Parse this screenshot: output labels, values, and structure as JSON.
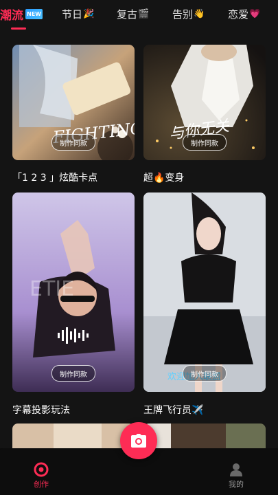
{
  "tabs": [
    {
      "label": "潮流",
      "badge": "NEW",
      "active": true
    },
    {
      "label": "节日",
      "emoji": "🎉"
    },
    {
      "label": "复古",
      "emoji": "🎬"
    },
    {
      "label": "告别",
      "emoji": "👋"
    },
    {
      "label": "恋爱",
      "emoji": "💗"
    }
  ],
  "cards": [
    {
      "title": "「1 2 3 」炫酷卡点",
      "button": "制作同款",
      "overlay_text": "FIGHTING!"
    },
    {
      "title": "超🔥变身",
      "button": "制作同款",
      "overlay_text": "与你无关"
    },
    {
      "title": "字幕投影玩法",
      "button": "制作同款",
      "overlay_text": "ETIE"
    },
    {
      "title": "王牌飞行员✈️",
      "button": "制作同款",
      "overlay_text": "欢迎加入联盟"
    }
  ],
  "bottom_nav": {
    "create": {
      "label": "创作",
      "icon": "create-icon",
      "active": true
    },
    "me": {
      "label": "我的",
      "icon": "profile-icon"
    }
  },
  "colors": {
    "accent": "#fe2c55",
    "background": "#141414"
  }
}
